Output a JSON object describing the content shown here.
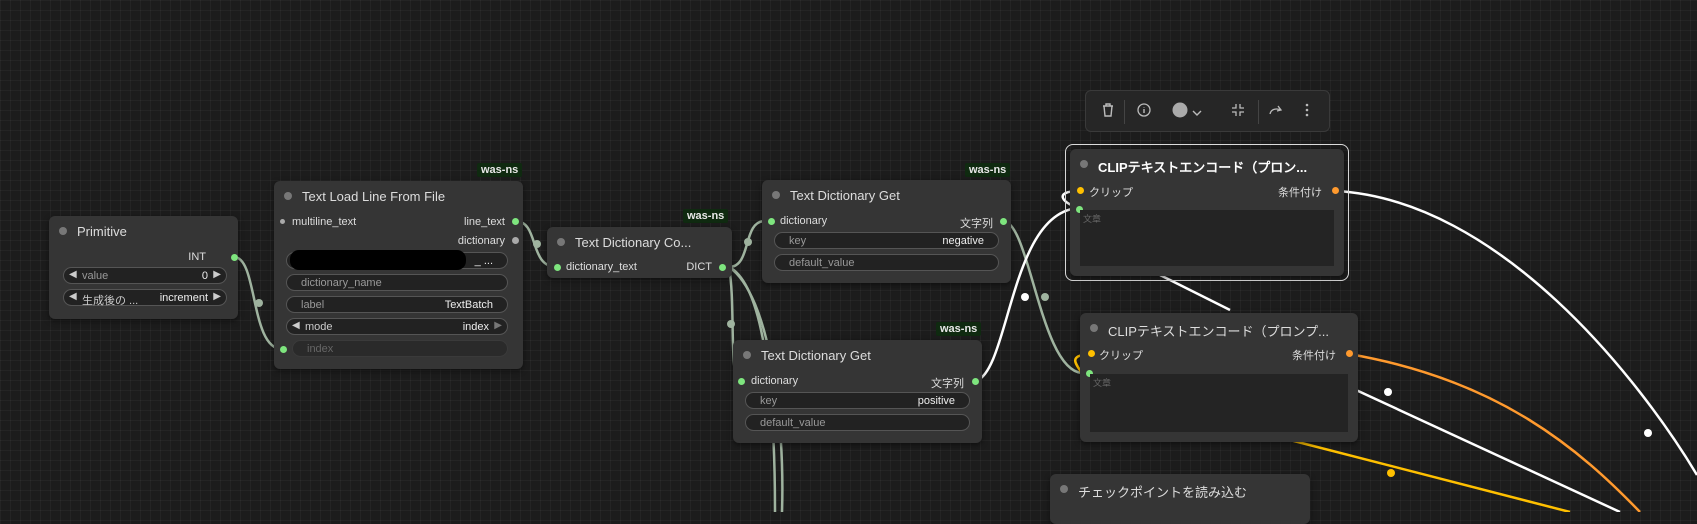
{
  "toolbar": {
    "icons": [
      "trash-icon",
      "info-icon",
      "color-circle-icon",
      "chevron-down-icon",
      "collapse-icon",
      "redo-icon",
      "more-vertical-icon"
    ]
  },
  "nodes": {
    "primitive": {
      "title": "Primitive",
      "output": "INT",
      "value_label": "value",
      "value": "0",
      "control_label": "生成後の ...",
      "control_value": "increment"
    },
    "load_line": {
      "tag": "was-ns",
      "title": "Text Load Line From File",
      "input_multiline": "multiline_text",
      "out_line_text": "line_text",
      "out_dictionary": "dictionary",
      "redacted_suffix": "_ ...",
      "dictionary_name": "dictionary_name",
      "label_label": "label",
      "label_value": "TextBatch",
      "mode_label": "mode",
      "mode_value": "index",
      "index_label": "index"
    },
    "dict_concat": {
      "tag": "was-ns",
      "title": "Text Dictionary Co...",
      "input": "dictionary_text",
      "output": "DICT"
    },
    "dict_get_neg": {
      "tag": "was-ns",
      "title": "Text Dictionary Get",
      "input": "dictionary",
      "output": "文字列",
      "key_label": "key",
      "key_value": "negative",
      "default_label": "default_value"
    },
    "dict_get_pos": {
      "tag": "was-ns",
      "title": "Text Dictionary Get",
      "input": "dictionary",
      "output": "文字列",
      "key_label": "key",
      "key_value": "positive",
      "default_label": "default_value"
    },
    "clip1": {
      "title": "CLIPテキストエンコード（プロン...",
      "input_clip": "クリップ",
      "output": "条件付け",
      "text_placeholder": "文章"
    },
    "clip2": {
      "title": "CLIPテキストエンコード（プロンプ...",
      "input_clip": "クリップ",
      "output": "条件付け",
      "text_placeholder": "文章"
    },
    "checkpoint": {
      "title": "チェックポイントを読み込む"
    }
  },
  "colors": {
    "canvas": "#1c1c1c",
    "node": "#353535",
    "port_green": "#7ee57e",
    "port_yellow": "#ffc000",
    "port_orange": "#ff9a2e",
    "tag_bg": "#0f2a10"
  }
}
